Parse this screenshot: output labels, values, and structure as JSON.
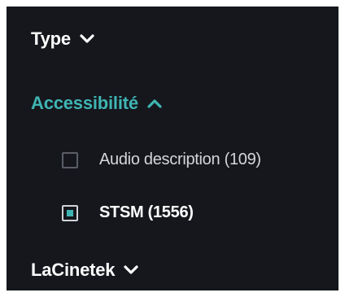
{
  "colors": {
    "panel_background": "#15171d",
    "accent": "#3fb5b3",
    "text": "#ffffff",
    "muted_text": "#d4d6da"
  },
  "filters": {
    "type": {
      "label": "Type",
      "state": "collapsed",
      "icon": "chevron-down-icon"
    },
    "accessibilite": {
      "label": "Accessibilité",
      "state": "expanded",
      "icon": "chevron-up-icon",
      "options": [
        {
          "label": "Audio description (109)",
          "checked": false
        },
        {
          "label": "STSM (1556)",
          "checked": true
        }
      ]
    },
    "lacinetek": {
      "label": "LaCinetek",
      "state": "collapsed",
      "icon": "chevron-down-icon"
    }
  }
}
